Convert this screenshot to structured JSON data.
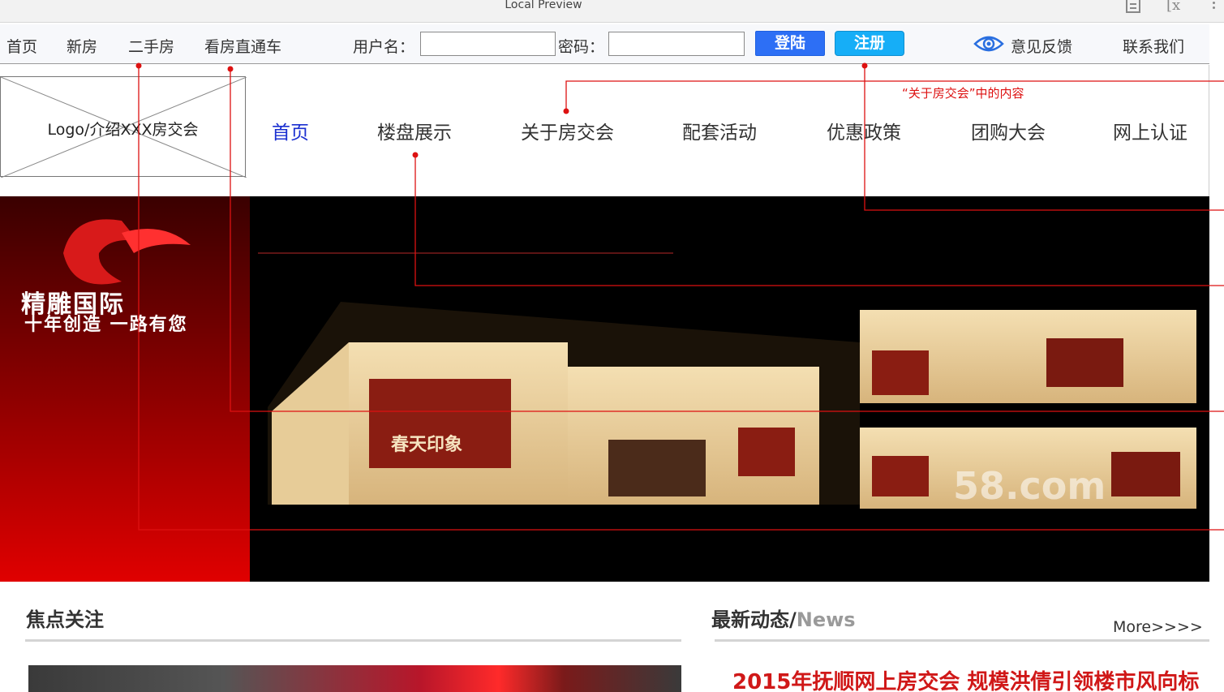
{
  "chrome": {
    "title": "Local Preview",
    "icons": [
      "document-icon",
      "formula-icon",
      "more-vert-icon"
    ]
  },
  "topbar": {
    "links": [
      "首页",
      "新房",
      "二手房",
      "看房直通车"
    ],
    "username_label": "用户名：",
    "username_value": "",
    "password_label": "密码：",
    "password_value": "",
    "login_label": "登陆",
    "register_label": "注册",
    "feedback_label": "意见反馈",
    "contact_label": "联系我们"
  },
  "header": {
    "logo_text": "Logo/介绍XXX房交会",
    "nav": [
      "首页",
      "楼盘展示",
      "关于房交会",
      "配套活动",
      "优惠政策",
      "团购大会",
      "网上认证"
    ],
    "active_nav": "首页",
    "annotation": "“关于房交会”中的内容"
  },
  "banner": {
    "brand_cn": "精雕国际",
    "slogan": "十年创造 一路有您",
    "booth_sign": "春天印象",
    "watermark": "58.com"
  },
  "focus": {
    "title": "焦点关注"
  },
  "news": {
    "title_cn": "最新动态/",
    "title_en": "News",
    "more_label": "More>>>>",
    "headline": "2015年抚顺网上房交会 规模洪倩引领楼市风向标"
  },
  "colors": {
    "annotation": "#dd1111",
    "active_nav": "#1a2fd0",
    "login": "#2d6ff5",
    "register": "#16aef7",
    "headline": "#d01818"
  }
}
